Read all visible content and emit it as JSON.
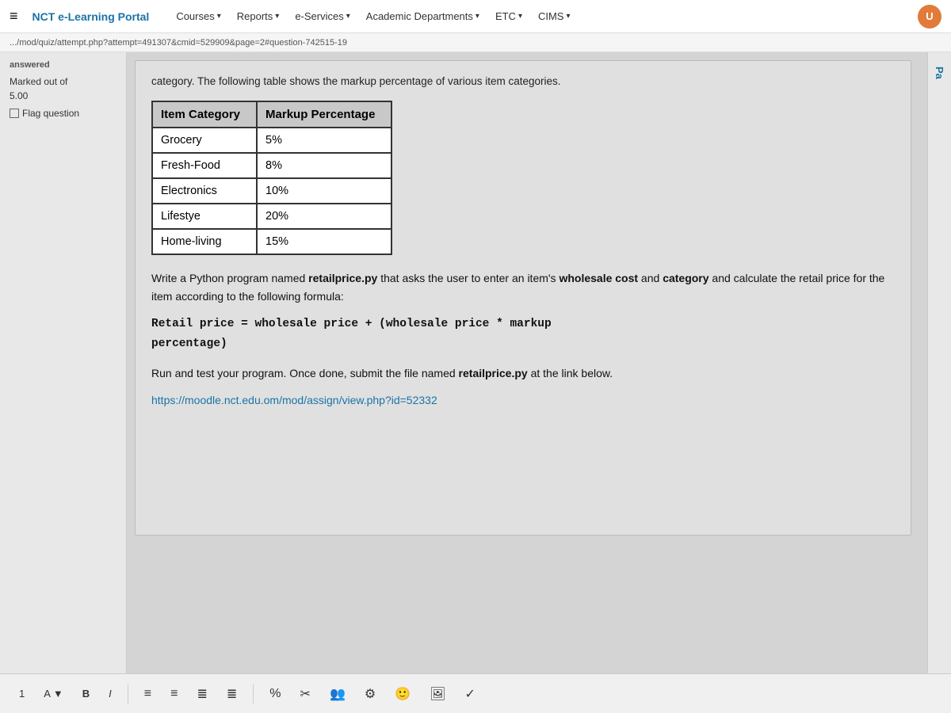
{
  "navbar": {
    "hamburger": "≡",
    "brand": "NCT e-Learning Portal",
    "menu_items": [
      {
        "label": "Courses",
        "has_arrow": true
      },
      {
        "label": "Reports",
        "has_arrow": true
      },
      {
        "label": "e-Services",
        "has_arrow": true
      },
      {
        "label": "Academic Departments",
        "has_arrow": true
      },
      {
        "label": "ETC",
        "has_arrow": true
      },
      {
        "label": "CIMS",
        "has_arrow": true
      }
    ],
    "avatar_initials": "U"
  },
  "address_bar": {
    "url": ".../mod/quiz/attempt.php?attempt=491307&cmid=529909&page=2#question-742515-19"
  },
  "sidebar": {
    "answered_label": "answered",
    "marked_out_of": "Marked out of",
    "score": "5.00",
    "flag_label": "Flag question"
  },
  "content": {
    "intro_text": "category. The following table shows the markup percentage of various item categories.",
    "table": {
      "headers": [
        "Item Category",
        "Markup Percentage"
      ],
      "rows": [
        [
          "Grocery",
          "5%"
        ],
        [
          "Fresh-Food",
          "8%"
        ],
        [
          "Electronics",
          "10%"
        ],
        [
          "Lifestye",
          "20%"
        ],
        [
          "Home-living",
          "15%"
        ]
      ]
    },
    "description": "Write a Python program named ",
    "program_name": "retailprice.py",
    "description2": " that asks the user to enter an item's ",
    "wholesale_cost": "wholesale cost",
    "and_text": " and ",
    "category": "category",
    "description3": " and calculate the retail price for the item  according to the following formula:",
    "formula_line1": "Retail price = wholesale price + (wholesale price * markup",
    "formula_line2": "percentage)",
    "run_text1": "Run and test your program. Once done, submit the file named ",
    "run_filename": "retailprice.py",
    "run_text2": " at the link below.",
    "submit_link": "https://moodle.nct.edu.om/mod/assign/view.php?id=52332",
    "pa_label": "Pa"
  },
  "toolbar": {
    "font_size_label": "1",
    "font_family_label": "A",
    "font_family_arrow": "▼",
    "bold_label": "B",
    "italic_label": "I",
    "list_icons": [
      "≡",
      "≡",
      "≡",
      "≡"
    ],
    "icons_right": [
      "◎",
      "✂",
      "⚙",
      "😊",
      "🖼"
    ]
  }
}
